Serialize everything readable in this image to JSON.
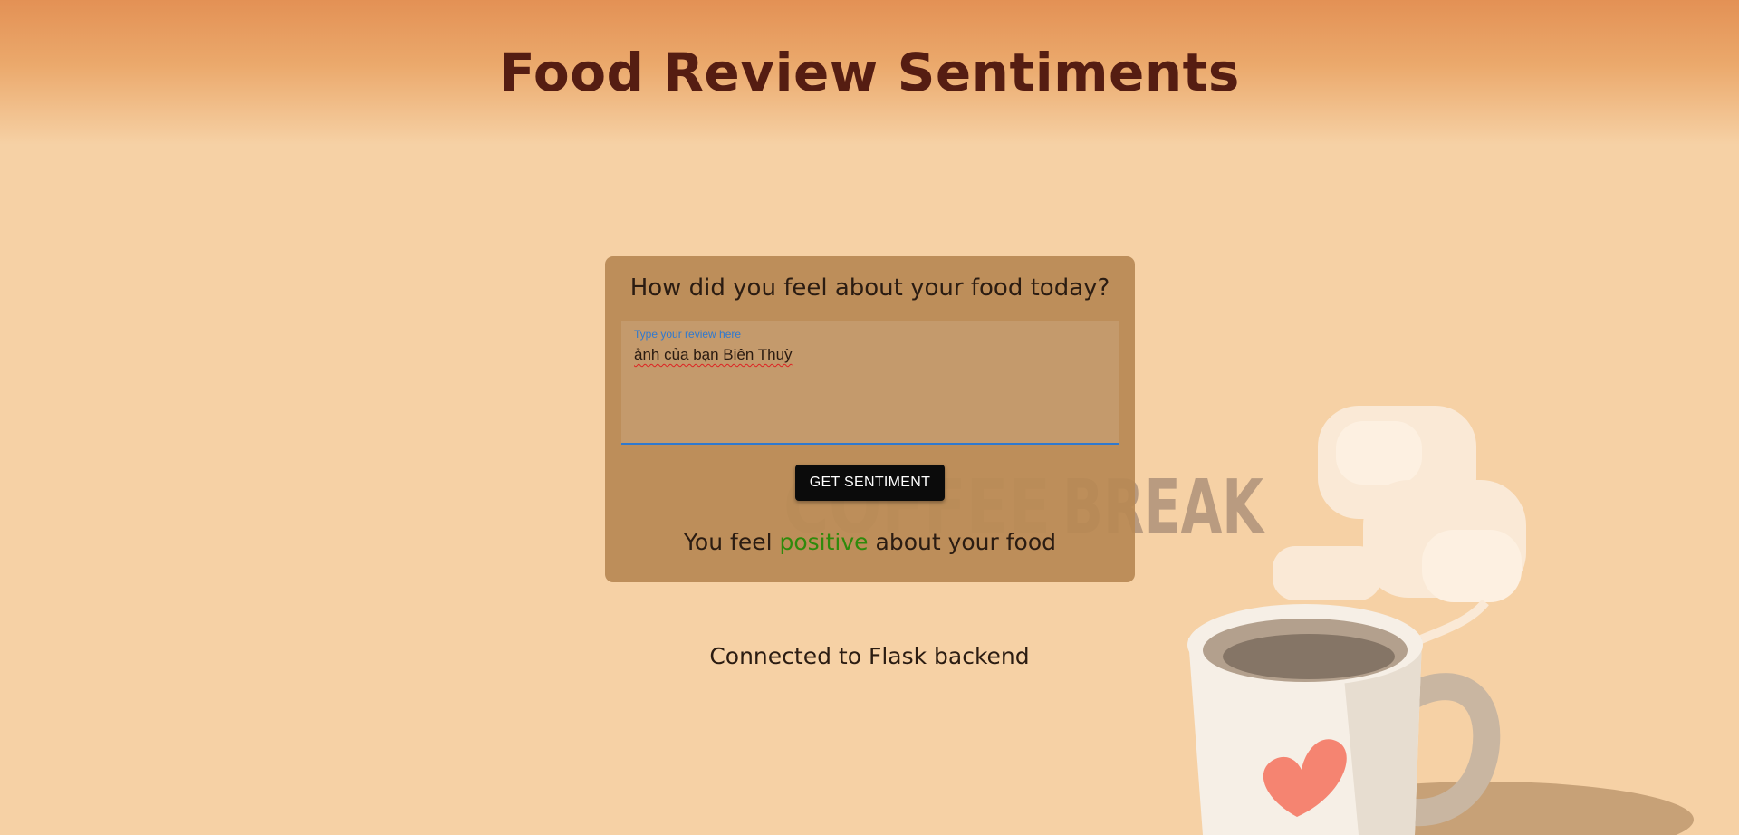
{
  "header": {
    "title": "Food Review Sentiments"
  },
  "card": {
    "question": "How did you feel about your food today?",
    "review": {
      "label": "Type your review here",
      "value": "ảnh của bạn Biên Thuỳ"
    },
    "button_label": "GET SENTIMENT",
    "result": {
      "prefix": "You feel",
      "sentiment": "positive",
      "suffix": "about your food"
    }
  },
  "status": {
    "text": "Connected to Flask backend"
  },
  "background": {
    "illustration_text": "COFFEE BREAK",
    "icon": "coffee-mug-with-heart"
  },
  "colors": {
    "title": "#551d12",
    "positive": "#2f8a0c",
    "button": "#0b0b0b",
    "focus_accent": "#2f79cf"
  }
}
